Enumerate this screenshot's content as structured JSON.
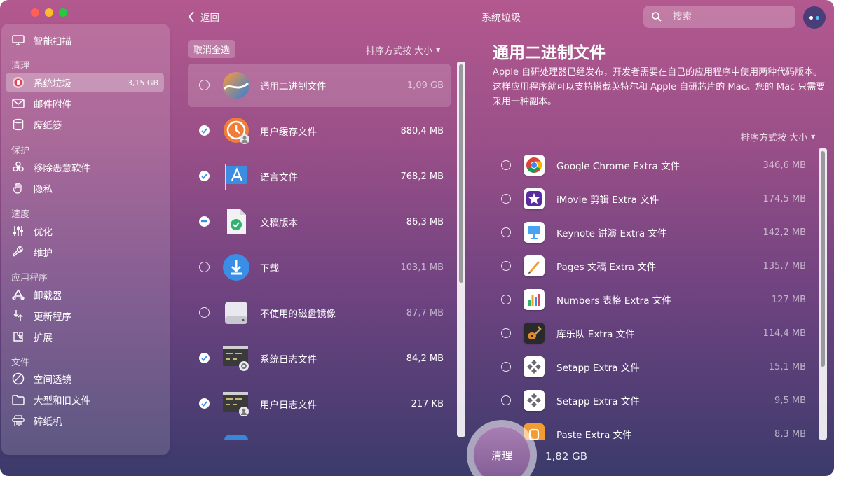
{
  "window": {
    "title": "系统垃圾",
    "back_label": "返回"
  },
  "search": {
    "placeholder": "搜索"
  },
  "sidebar": {
    "items": [
      {
        "label": "智能扫描",
        "icon": "monitor-icon"
      },
      {
        "label": "系统垃圾",
        "icon": "trash-can-icon",
        "size": "3,15 GB",
        "active": true
      },
      {
        "label": "邮件附件",
        "icon": "envelope-icon"
      },
      {
        "label": "废纸篓",
        "icon": "bin-icon"
      },
      {
        "label": "移除恶意软件",
        "icon": "biohazard-icon"
      },
      {
        "label": "隐私",
        "icon": "hand-icon"
      },
      {
        "label": "优化",
        "icon": "sliders-icon"
      },
      {
        "label": "维护",
        "icon": "wrench-icon"
      },
      {
        "label": "卸载器",
        "icon": "uninstaller-icon"
      },
      {
        "label": "更新程序",
        "icon": "updater-icon"
      },
      {
        "label": "扩展",
        "icon": "extension-icon"
      },
      {
        "label": "空间透镜",
        "icon": "lens-icon"
      },
      {
        "label": "大型和旧文件",
        "icon": "folder-icon"
      },
      {
        "label": "碎纸机",
        "icon": "shredder-icon"
      }
    ],
    "sections": [
      "清理",
      "保护",
      "速度",
      "应用程序",
      "文件"
    ]
  },
  "list": {
    "deselect_label": "取消全选",
    "sort_label": "排序方式按 大小",
    "rows": [
      {
        "name": "通用二进制文件",
        "size": "1,09 GB",
        "state": "off",
        "selected": true,
        "icon": "universal-binary-icon"
      },
      {
        "name": "用户缓存文件",
        "size": "880,4 MB",
        "state": "on",
        "icon": "user-cache-icon"
      },
      {
        "name": "语言文件",
        "size": "768,2 MB",
        "state": "on",
        "icon": "language-files-icon"
      },
      {
        "name": "文稿版本",
        "size": "86,3 MB",
        "state": "partial",
        "icon": "document-versions-icon"
      },
      {
        "name": "下载",
        "size": "103,1 MB",
        "state": "off",
        "icon": "download-icon"
      },
      {
        "name": "不使用的磁盘镜像",
        "size": "87,7 MB",
        "state": "off",
        "icon": "disk-image-icon"
      },
      {
        "name": "系统日志文件",
        "size": "84,2 MB",
        "state": "on",
        "icon": "system-log-icon"
      },
      {
        "name": "用户日志文件",
        "size": "217 KB",
        "state": "on",
        "icon": "user-log-icon"
      }
    ]
  },
  "detail": {
    "title": "通用二进制文件",
    "description": "Apple 自研处理器已经发布，开发者需要在自己的应用程序中使用两种代码版本。这样应用程序就可以支持搭载英特尔和 Apple 自研芯片的 Mac。您的 Mac 只需要采用一种副本。",
    "sort_label": "排序方式按 大小",
    "rows": [
      {
        "name": "Google Chrome Extra 文件",
        "size": "346,6 MB",
        "icon": "chrome-icon"
      },
      {
        "name": "iMovie 剪辑 Extra 文件",
        "size": "174,5 MB",
        "icon": "imovie-icon"
      },
      {
        "name": "Keynote 讲演 Extra 文件",
        "size": "142,2 MB",
        "icon": "keynote-icon"
      },
      {
        "name": "Pages 文稿 Extra 文件",
        "size": "135,7 MB",
        "icon": "pages-icon"
      },
      {
        "name": "Numbers 表格 Extra 文件",
        "size": "127 MB",
        "icon": "numbers-icon"
      },
      {
        "name": "库乐队 Extra 文件",
        "size": "114,4 MB",
        "icon": "garageband-icon"
      },
      {
        "name": "Setapp Extra 文件",
        "size": "15,1 MB",
        "icon": "setapp-icon"
      },
      {
        "name": "Setapp Extra 文件",
        "size": "9,5 MB",
        "icon": "setapp-icon"
      },
      {
        "name": "Paste Extra 文件",
        "size": "8,3 MB",
        "icon": "paste-icon"
      }
    ]
  },
  "clean": {
    "label": "清理",
    "size": "1,82 GB"
  },
  "colors": {
    "accent": "#8a5aa0",
    "check_on": "#ffffff",
    "check_mark": "#3a8ee6"
  }
}
